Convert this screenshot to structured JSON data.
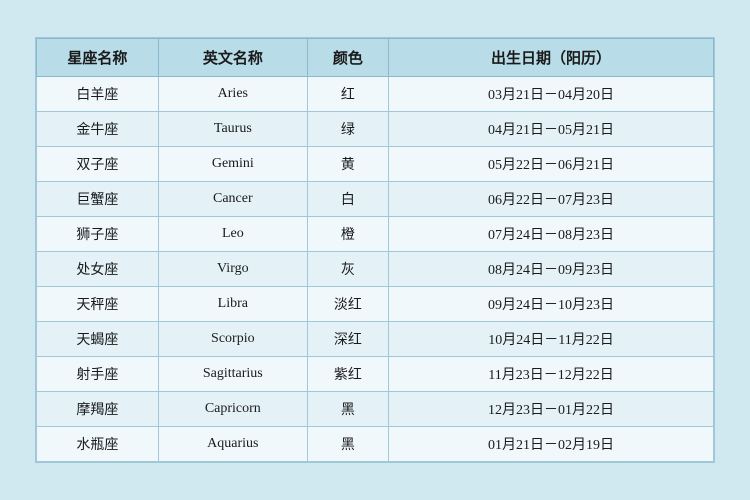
{
  "table": {
    "headers": {
      "col1": "星座名称",
      "col2": "英文名称",
      "col3": "颜色",
      "col4": "出生日期（阳历）"
    },
    "rows": [
      {
        "chinese": "白羊座",
        "english": "Aries",
        "color": "红",
        "date": "03月21日－04月20日"
      },
      {
        "chinese": "金牛座",
        "english": "Taurus",
        "color": "绿",
        "date": "04月21日－05月21日"
      },
      {
        "chinese": "双子座",
        "english": "Gemini",
        "color": "黄",
        "date": "05月22日－06月21日"
      },
      {
        "chinese": "巨蟹座",
        "english": "Cancer",
        "color": "白",
        "date": "06月22日－07月23日"
      },
      {
        "chinese": "狮子座",
        "english": "Leo",
        "color": "橙",
        "date": "07月24日－08月23日"
      },
      {
        "chinese": "处女座",
        "english": "Virgo",
        "color": "灰",
        "date": "08月24日－09月23日"
      },
      {
        "chinese": "天秤座",
        "english": "Libra",
        "color": "淡红",
        "date": "09月24日－10月23日"
      },
      {
        "chinese": "天蝎座",
        "english": "Scorpio",
        "color": "深红",
        "date": "10月24日－11月22日"
      },
      {
        "chinese": "射手座",
        "english": "Sagittarius",
        "color": "紫红",
        "date": "11月23日－12月22日"
      },
      {
        "chinese": "摩羯座",
        "english": "Capricorn",
        "color": "黑",
        "date": "12月23日－01月22日"
      },
      {
        "chinese": "水瓶座",
        "english": "Aquarius",
        "color": "黑",
        "date": "01月21日－02月19日"
      }
    ]
  }
}
